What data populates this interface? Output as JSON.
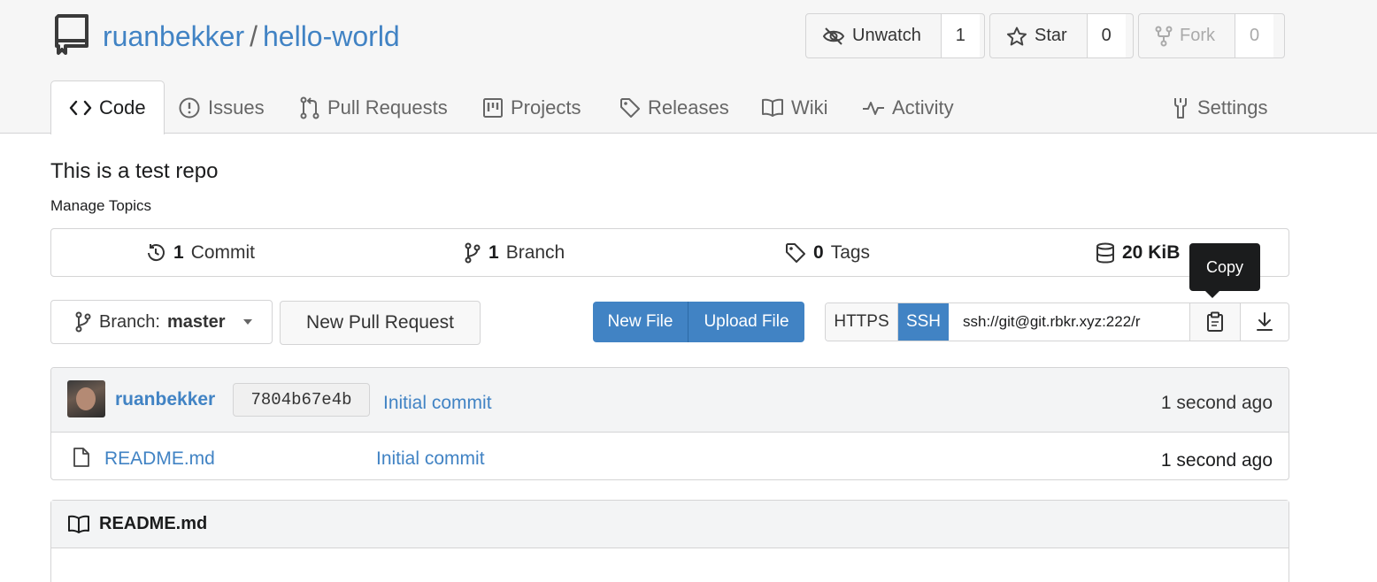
{
  "repo": {
    "owner": "ruanbekker",
    "name": "hello-world",
    "separator": "/"
  },
  "actions": {
    "watch": {
      "label": "Unwatch",
      "count": "1"
    },
    "star": {
      "label": "Star",
      "count": "0"
    },
    "fork": {
      "label": "Fork",
      "count": "0"
    }
  },
  "tabs": [
    {
      "label": "Code",
      "icon": "code-icon",
      "active": true
    },
    {
      "label": "Issues",
      "icon": "issue-icon"
    },
    {
      "label": "Pull Requests",
      "icon": "pull-request-icon"
    },
    {
      "label": "Projects",
      "icon": "project-icon"
    },
    {
      "label": "Releases",
      "icon": "tag-icon"
    },
    {
      "label": "Wiki",
      "icon": "book-icon"
    },
    {
      "label": "Activity",
      "icon": "pulse-icon"
    },
    {
      "label": "Settings",
      "icon": "tools-icon"
    }
  ],
  "description": "This is a test repo",
  "manage_topics": "Manage Topics",
  "stats": {
    "commits": {
      "num": "1",
      "label": "Commit"
    },
    "branches": {
      "num": "1",
      "label": "Branch"
    },
    "tags": {
      "num": "0",
      "label": "Tags"
    },
    "size": {
      "num": "20 KiB"
    }
  },
  "tooltip": "Copy",
  "branch": {
    "prefix": "Branch:",
    "name": "master"
  },
  "new_pull_request": "New Pull Request",
  "new_file": "New File",
  "upload_file": "Upload File",
  "clone": {
    "https": "HTTPS",
    "ssh": "SSH",
    "url": "ssh://git@git.rbkr.xyz:222/r"
  },
  "latest_commit": {
    "author": "ruanbekker",
    "sha": "7804b67e4b",
    "message": "Initial commit",
    "time": "1 second ago"
  },
  "files": [
    {
      "name": "README.md",
      "message": "Initial commit",
      "time": "1 second ago"
    }
  ],
  "readme": {
    "title": "README.md"
  },
  "colors": {
    "link": "#4183c4",
    "primary": "#4183c4",
    "border": "#d4d4d5"
  }
}
